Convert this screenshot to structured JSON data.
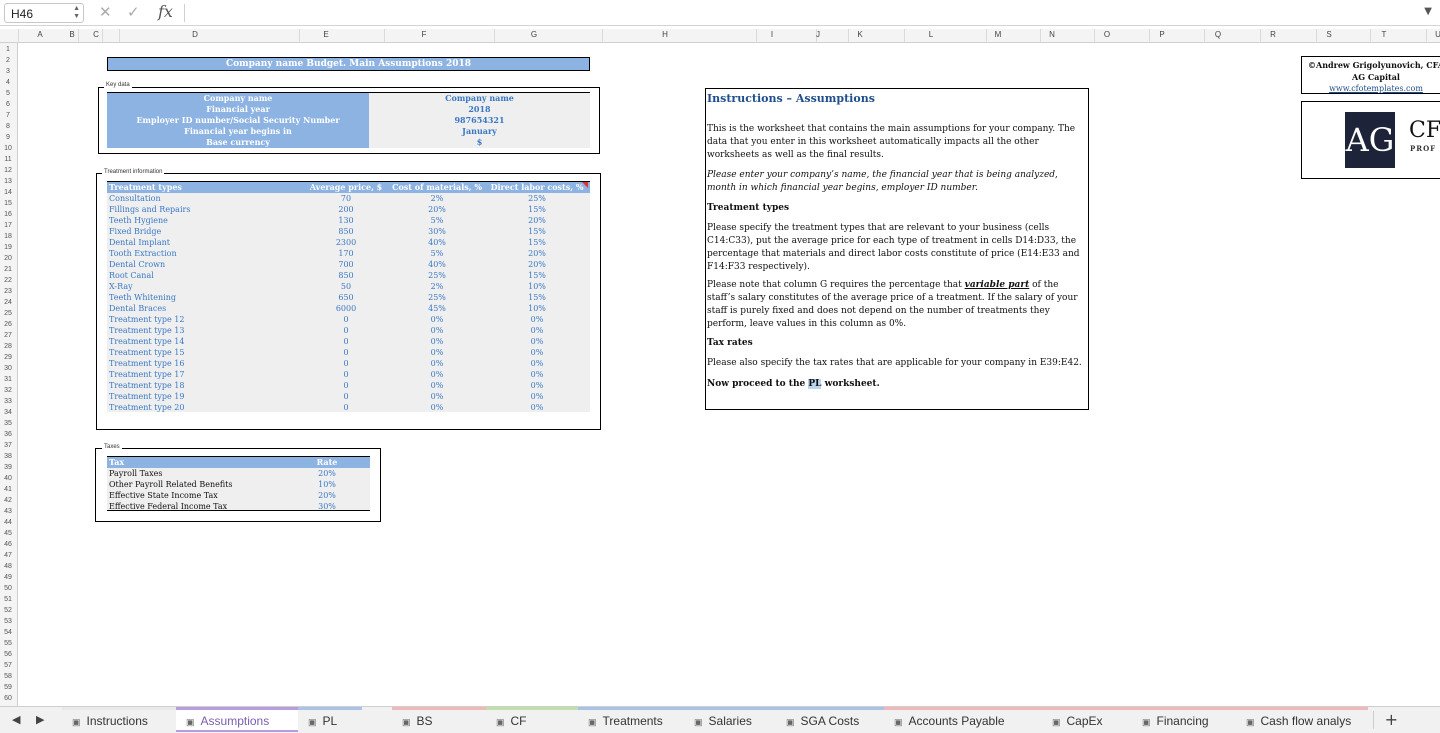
{
  "formula_bar": {
    "name_box": "H46",
    "formula": "",
    "fx": "fx"
  },
  "columns": [
    "A",
    "B",
    "C",
    "D",
    "E",
    "F",
    "G",
    "H",
    "I",
    "J",
    "K",
    "L",
    "M",
    "N",
    "O",
    "P",
    "Q",
    "R",
    "S",
    "T",
    "U"
  ],
  "rows": [
    "1",
    "2",
    "3",
    "4",
    "5",
    "6",
    "7",
    "8",
    "9",
    "10",
    "11",
    "12",
    "13",
    "14",
    "15",
    "16",
    "17",
    "18",
    "19",
    "20",
    "21",
    "22",
    "23",
    "24",
    "25",
    "26",
    "27",
    "28",
    "29",
    "30",
    "31",
    "32",
    "33",
    "34",
    "35",
    "36",
    "37",
    "38",
    "39",
    "40",
    "41",
    "42",
    "43",
    "44",
    "45",
    "46",
    "47",
    "48",
    "49",
    "50",
    "51",
    "52",
    "53",
    "54",
    "55",
    "56",
    "57",
    "58",
    "59",
    "60"
  ],
  "sheet_title": "Company name Budget. Main Assumptions 2018",
  "key_data": {
    "label": "Key data",
    "fields": [
      "Company name",
      "Financial year",
      "Employer ID number/Social Security Number",
      "Financial year begins in",
      "Base currency"
    ],
    "values": [
      "Company name",
      "2018",
      "987654321",
      "January",
      "$"
    ]
  },
  "treatment": {
    "label": "Treatment information",
    "headers": [
      "Treatment types",
      "Average price, $",
      "Cost of materials, %",
      "Direct labor costs, %"
    ],
    "rows": [
      [
        "Consultation",
        "70",
        "2%",
        "25%"
      ],
      [
        "Fillings and Repairs",
        "200",
        "20%",
        "15%"
      ],
      [
        "Teeth Hygiene",
        "130",
        "5%",
        "20%"
      ],
      [
        "Fixed Bridge",
        "850",
        "30%",
        "15%"
      ],
      [
        "Dental Implant",
        "2300",
        "40%",
        "15%"
      ],
      [
        "Tooth Extraction",
        "170",
        "5%",
        "20%"
      ],
      [
        "Dental Crown",
        "700",
        "40%",
        "20%"
      ],
      [
        "Root Canal",
        "850",
        "25%",
        "15%"
      ],
      [
        "X-Ray",
        "50",
        "2%",
        "10%"
      ],
      [
        "Teeth Whitening",
        "650",
        "25%",
        "15%"
      ],
      [
        "Dental Braces",
        "6000",
        "45%",
        "10%"
      ],
      [
        "Treatment type 12",
        "0",
        "0%",
        "0%"
      ],
      [
        "Treatment type 13",
        "0",
        "0%",
        "0%"
      ],
      [
        "Treatment type 14",
        "0",
        "0%",
        "0%"
      ],
      [
        "Treatment type 15",
        "0",
        "0%",
        "0%"
      ],
      [
        "Treatment type 16",
        "0",
        "0%",
        "0%"
      ],
      [
        "Treatment type 17",
        "0",
        "0%",
        "0%"
      ],
      [
        "Treatment type 18",
        "0",
        "0%",
        "0%"
      ],
      [
        "Treatment type 19",
        "0",
        "0%",
        "0%"
      ],
      [
        "Treatment type 20",
        "0",
        "0%",
        "0%"
      ]
    ]
  },
  "taxes": {
    "label": "Taxes",
    "headers": [
      "Tax",
      "Rate"
    ],
    "rows": [
      [
        "Payroll Taxes",
        "20%"
      ],
      [
        "Other Payroll Related Benefits",
        "10%"
      ],
      [
        "Effective State Income Tax",
        "20%"
      ],
      [
        "Effective Federal Income Tax",
        "30%"
      ]
    ]
  },
  "instructions": {
    "title": "Instructions – Assumptions",
    "p1": "This is the worksheet that contains the main assumptions for your company. The data that you enter in this worksheet automatically impacts all the other worksheets as well as the final results.",
    "p2": "Please enter your company’s name, the financial year that is being analyzed, month in which financial year begins, employer ID number.",
    "h_treatment": "Treatment types",
    "p3": "Please specify the treatment types that are relevant to your business (cells C14:C33), put the average price for each type of treatment in cells D14:D33, the percentage that materials and direct labor costs constitute of price (E14:E33 and F14:F33 respectively).",
    "p4_a": "Please note that column G requires the percentage that ",
    "p4_u": "variable part",
    "p4_b": " of the staff’s salary constitutes of the average price of a treatment. If the salary of your staff is purely fixed and does not depend on the number of treatments they perform, leave values in this column as 0%.",
    "h_tax": "Tax rates",
    "p5": "Please also specify the tax rates that are applicable for your company in E39:E42.",
    "p6_a": "Now proceed to the ",
    "p6_hl": "PL",
    "p6_b": " worksheet."
  },
  "branding": {
    "author": "©Andrew Grigolyunovich, CFA",
    "company": "AG Capital",
    "link": "www.cfotemplates.com",
    "logo_mark": "AG",
    "logo_text": "CF",
    "logo_sub": "PROF"
  },
  "tabs": [
    {
      "label": "Instructions",
      "color": "#e9e9e9"
    },
    {
      "label": "Assumptions",
      "color": "#b79de0"
    },
    {
      "label": "PL",
      "color": "#a9c3e8"
    },
    {
      "label": "BS",
      "color": "#f0b8b8"
    },
    {
      "label": "CF",
      "color": "#bfe0a8"
    },
    {
      "label": "Treatments",
      "color": "#a9c3e8"
    },
    {
      "label": "Salaries",
      "color": "#a9c3e8"
    },
    {
      "label": "SGA Costs",
      "color": "#a9c3e8"
    },
    {
      "label": "Accounts Payable",
      "color": "#f0b8b8"
    },
    {
      "label": "CapEx",
      "color": "#f0b8b8"
    },
    {
      "label": "Financing",
      "color": "#f0b8b8"
    },
    {
      "label": "Cash flow analys",
      "color": "#f0b8b8"
    }
  ]
}
